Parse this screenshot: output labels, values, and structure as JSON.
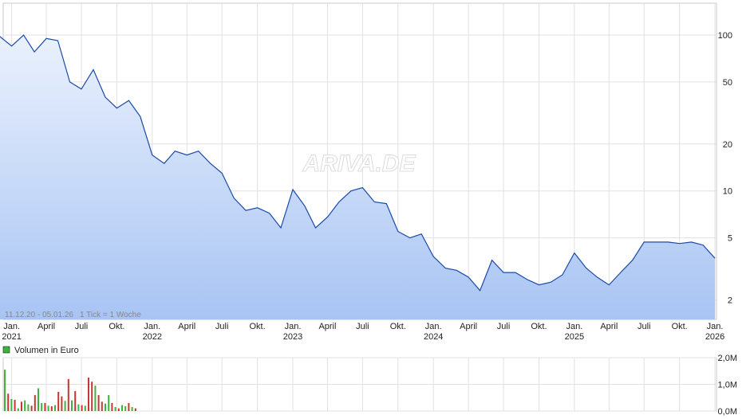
{
  "chart_data": [
    {
      "type": "area",
      "scale": "log",
      "ylim": [
        1.5,
        160
      ],
      "grid": true,
      "watermark": "ARIVA.DE",
      "range_label": "11.12.20 - 05.01.26",
      "tick_label": "1 Tick = 1 Woche",
      "line_color": "#1a4aa8",
      "fill_color": "#a8c4f3",
      "y_ticks": [
        "100",
        "50",
        "20",
        "10",
        "5",
        "2"
      ],
      "y_tick_values": [
        100,
        50,
        20,
        10,
        5,
        2
      ],
      "x_tick_labels": [
        {
          "month": "Jan.",
          "year": "2021"
        },
        {
          "month": "April",
          "year": ""
        },
        {
          "month": "Juli",
          "year": ""
        },
        {
          "month": "Okt.",
          "year": ""
        },
        {
          "month": "Jan.",
          "year": "2022"
        },
        {
          "month": "April",
          "year": ""
        },
        {
          "month": "Juli",
          "year": ""
        },
        {
          "month": "Okt.",
          "year": ""
        },
        {
          "month": "Jan.",
          "year": "2023"
        },
        {
          "month": "April",
          "year": ""
        },
        {
          "month": "Juli",
          "year": ""
        },
        {
          "month": "Okt.",
          "year": ""
        },
        {
          "month": "Jan.",
          "year": "2024"
        },
        {
          "month": "April",
          "year": ""
        },
        {
          "month": "Juli",
          "year": ""
        },
        {
          "month": "Okt.",
          "year": ""
        },
        {
          "month": "Jan.",
          "year": "2025"
        },
        {
          "month": "April",
          "year": ""
        },
        {
          "month": "Juli",
          "year": ""
        },
        {
          "month": "Okt.",
          "year": ""
        },
        {
          "month": "Jan.",
          "year": "2026"
        }
      ],
      "x_tick_dates": [
        "2021-01",
        "2021-04",
        "2021-07",
        "2021-10",
        "2022-01",
        "2022-04",
        "2022-07",
        "2022-10",
        "2023-01",
        "2023-04",
        "2023-07",
        "2023-10",
        "2024-01",
        "2024-04",
        "2024-07",
        "2024-10",
        "2025-01",
        "2025-04",
        "2025-07",
        "2025-10",
        "2026-01"
      ],
      "series": [
        {
          "x": [
            "2020-12",
            "2021-01",
            "2021-02",
            "2021-03",
            "2021-04",
            "2021-05",
            "2021-06",
            "2021-07",
            "2021-08",
            "2021-09",
            "2021-10",
            "2021-11",
            "2021-12",
            "2022-01",
            "2022-02",
            "2022-03",
            "2022-04",
            "2022-05",
            "2022-06",
            "2022-07",
            "2022-08",
            "2022-09",
            "2022-10",
            "2022-11",
            "2022-12",
            "2023-01",
            "2023-02",
            "2023-03",
            "2023-04",
            "2023-05",
            "2023-06",
            "2023-07",
            "2023-08",
            "2023-09",
            "2023-10",
            "2023-11",
            "2023-12",
            "2024-01",
            "2024-02",
            "2024-03",
            "2024-04",
            "2024-05",
            "2024-06",
            "2024-07",
            "2024-08",
            "2024-09",
            "2024-10",
            "2024-11",
            "2024-12",
            "2025-01",
            "2025-02",
            "2025-03",
            "2025-04",
            "2025-05",
            "2025-06",
            "2025-07",
            "2025-08",
            "2025-09",
            "2025-10",
            "2025-11",
            "2025-12",
            "2026-01"
          ],
          "values": [
            98,
            85,
            100,
            78,
            95,
            92,
            50,
            45,
            60,
            40,
            34,
            38,
            30,
            17,
            15,
            18,
            17,
            18,
            15,
            13,
            9.0,
            7.5,
            7.8,
            7.2,
            5.8,
            10.2,
            8.0,
            5.8,
            6.8,
            8.5,
            10.0,
            10.5,
            8.5,
            8.3,
            5.5,
            5.0,
            5.3,
            3.8,
            3.2,
            3.1,
            2.8,
            2.3,
            3.6,
            3.0,
            3.0,
            2.7,
            2.5,
            2.6,
            2.9,
            4.0,
            3.2,
            2.8,
            2.5,
            3.0,
            3.6,
            4.7,
            4.7,
            4.7,
            4.6,
            4.7,
            4.5,
            3.7
          ]
        }
      ]
    },
    {
      "type": "bar",
      "legend": "Volumen in Euro",
      "ylim": [
        0,
        2.0
      ],
      "y_ticks": [
        "2,0M",
        "1,0M",
        "0,0M"
      ],
      "y_tick_values": [
        2.0,
        1.0,
        0.0
      ],
      "up_color": "#3cb43c",
      "down_color": "#cc3333",
      "series": [
        {
          "name": "Volumen in Euro",
          "values": [
            1.55,
            0.65,
            0.45,
            0.42,
            0.1,
            0.35,
            0.4,
            0.25,
            0.2,
            0.6,
            0.85,
            0.3,
            0.3,
            0.2,
            0.18,
            0.22,
            0.72,
            0.55,
            0.38,
            1.2,
            0.4,
            0.75,
            0.25,
            0.22,
            0.2,
            1.25,
            1.1,
            0.95,
            0.6,
            0.35,
            0.28,
            0.6,
            0.3,
            0.15,
            0.1,
            0.22,
            0.18,
            0.3,
            0.15,
            0.1
          ],
          "direction": [
            "up",
            "down",
            "up",
            "down",
            "up",
            "down",
            "up",
            "up",
            "down",
            "down",
            "up",
            "up",
            "down",
            "up",
            "down",
            "up",
            "down",
            "down",
            "up",
            "down",
            "up",
            "down",
            "up",
            "down",
            "up",
            "down",
            "down",
            "up",
            "down",
            "down",
            "up",
            "up",
            "down",
            "up",
            "down",
            "up",
            "up",
            "down",
            "up",
            "down"
          ]
        }
      ]
    }
  ]
}
